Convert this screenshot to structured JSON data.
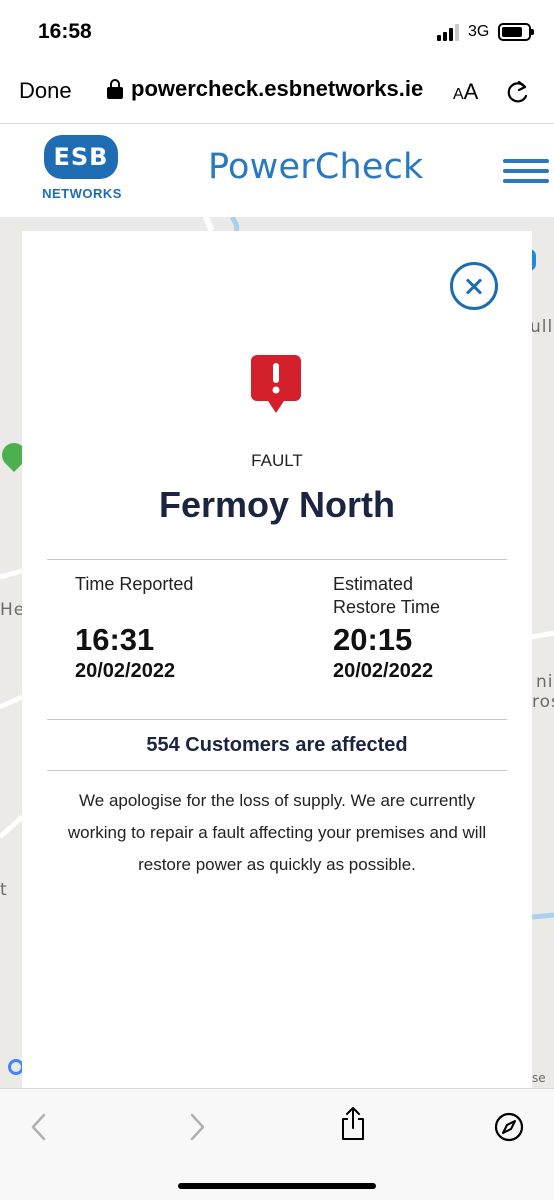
{
  "status_bar": {
    "time": "16:58",
    "network": "3G"
  },
  "browser": {
    "done_label": "Done",
    "url": "powercheck.esbnetworks.ie",
    "text_size_small": "A",
    "text_size_big": "A"
  },
  "header": {
    "logo_mark": "ESB",
    "logo_text": "NETWORKS",
    "brand": "PowerCheck"
  },
  "map": {
    "labels": [
      "ull",
      "He",
      "ni",
      "ros",
      "t",
      "se"
    ]
  },
  "card": {
    "status": "FAULT",
    "location": "Fermoy North",
    "time_reported_label": "Time Reported",
    "time_reported": "16:31",
    "date_reported": "20/02/2022",
    "restore_label_line1": "Estimated",
    "restore_label_line2": "Restore Time",
    "restore_time": "20:15",
    "restore_date": "20/02/2022",
    "affected": "554 Customers are affected",
    "message": "We apologise for the loss of supply. We are currently working to repair a fault affecting your premises and will restore power as quickly as possible."
  },
  "colors": {
    "brand_blue": "#2a78bf",
    "fault_red": "#d3202b",
    "title_navy": "#1b2440"
  }
}
